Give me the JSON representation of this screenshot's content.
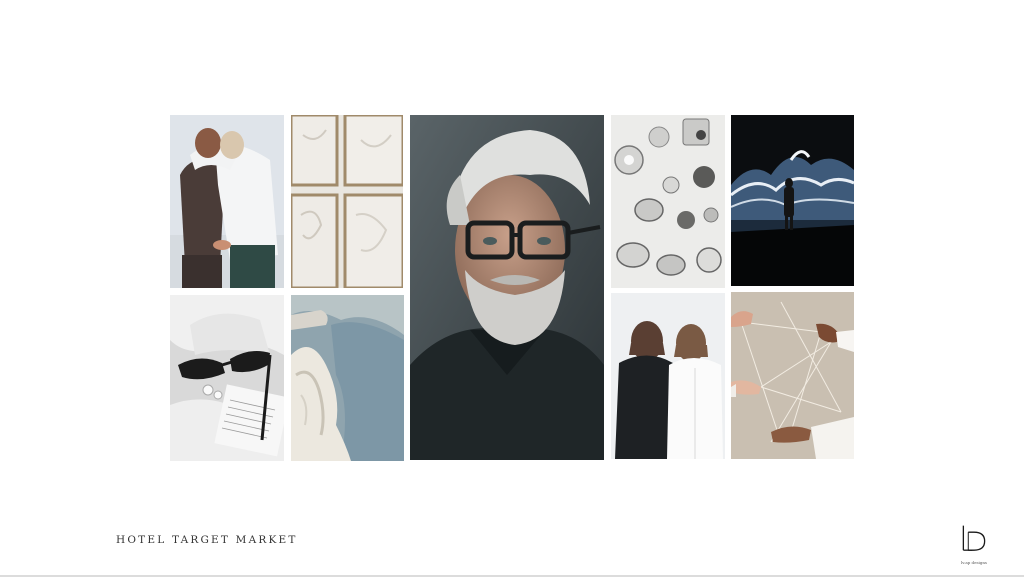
{
  "slide": {
    "caption": "HOTEL TARGET MARKET"
  },
  "logo": {
    "tagline": "lv.ap designs"
  },
  "tiles": [
    {
      "name": "couple-embrace-photo"
    },
    {
      "name": "white-plaster-frames-photo"
    },
    {
      "name": "bearded-man-glasses-portrait"
    },
    {
      "name": "glassware-tableware-photo"
    },
    {
      "name": "immersive-wave-art-photo"
    },
    {
      "name": "sunglasses-book-photo"
    },
    {
      "name": "white-rock-blue-sea-photo"
    },
    {
      "name": "two-women-coats-photo"
    },
    {
      "name": "hands-string-photo"
    }
  ]
}
